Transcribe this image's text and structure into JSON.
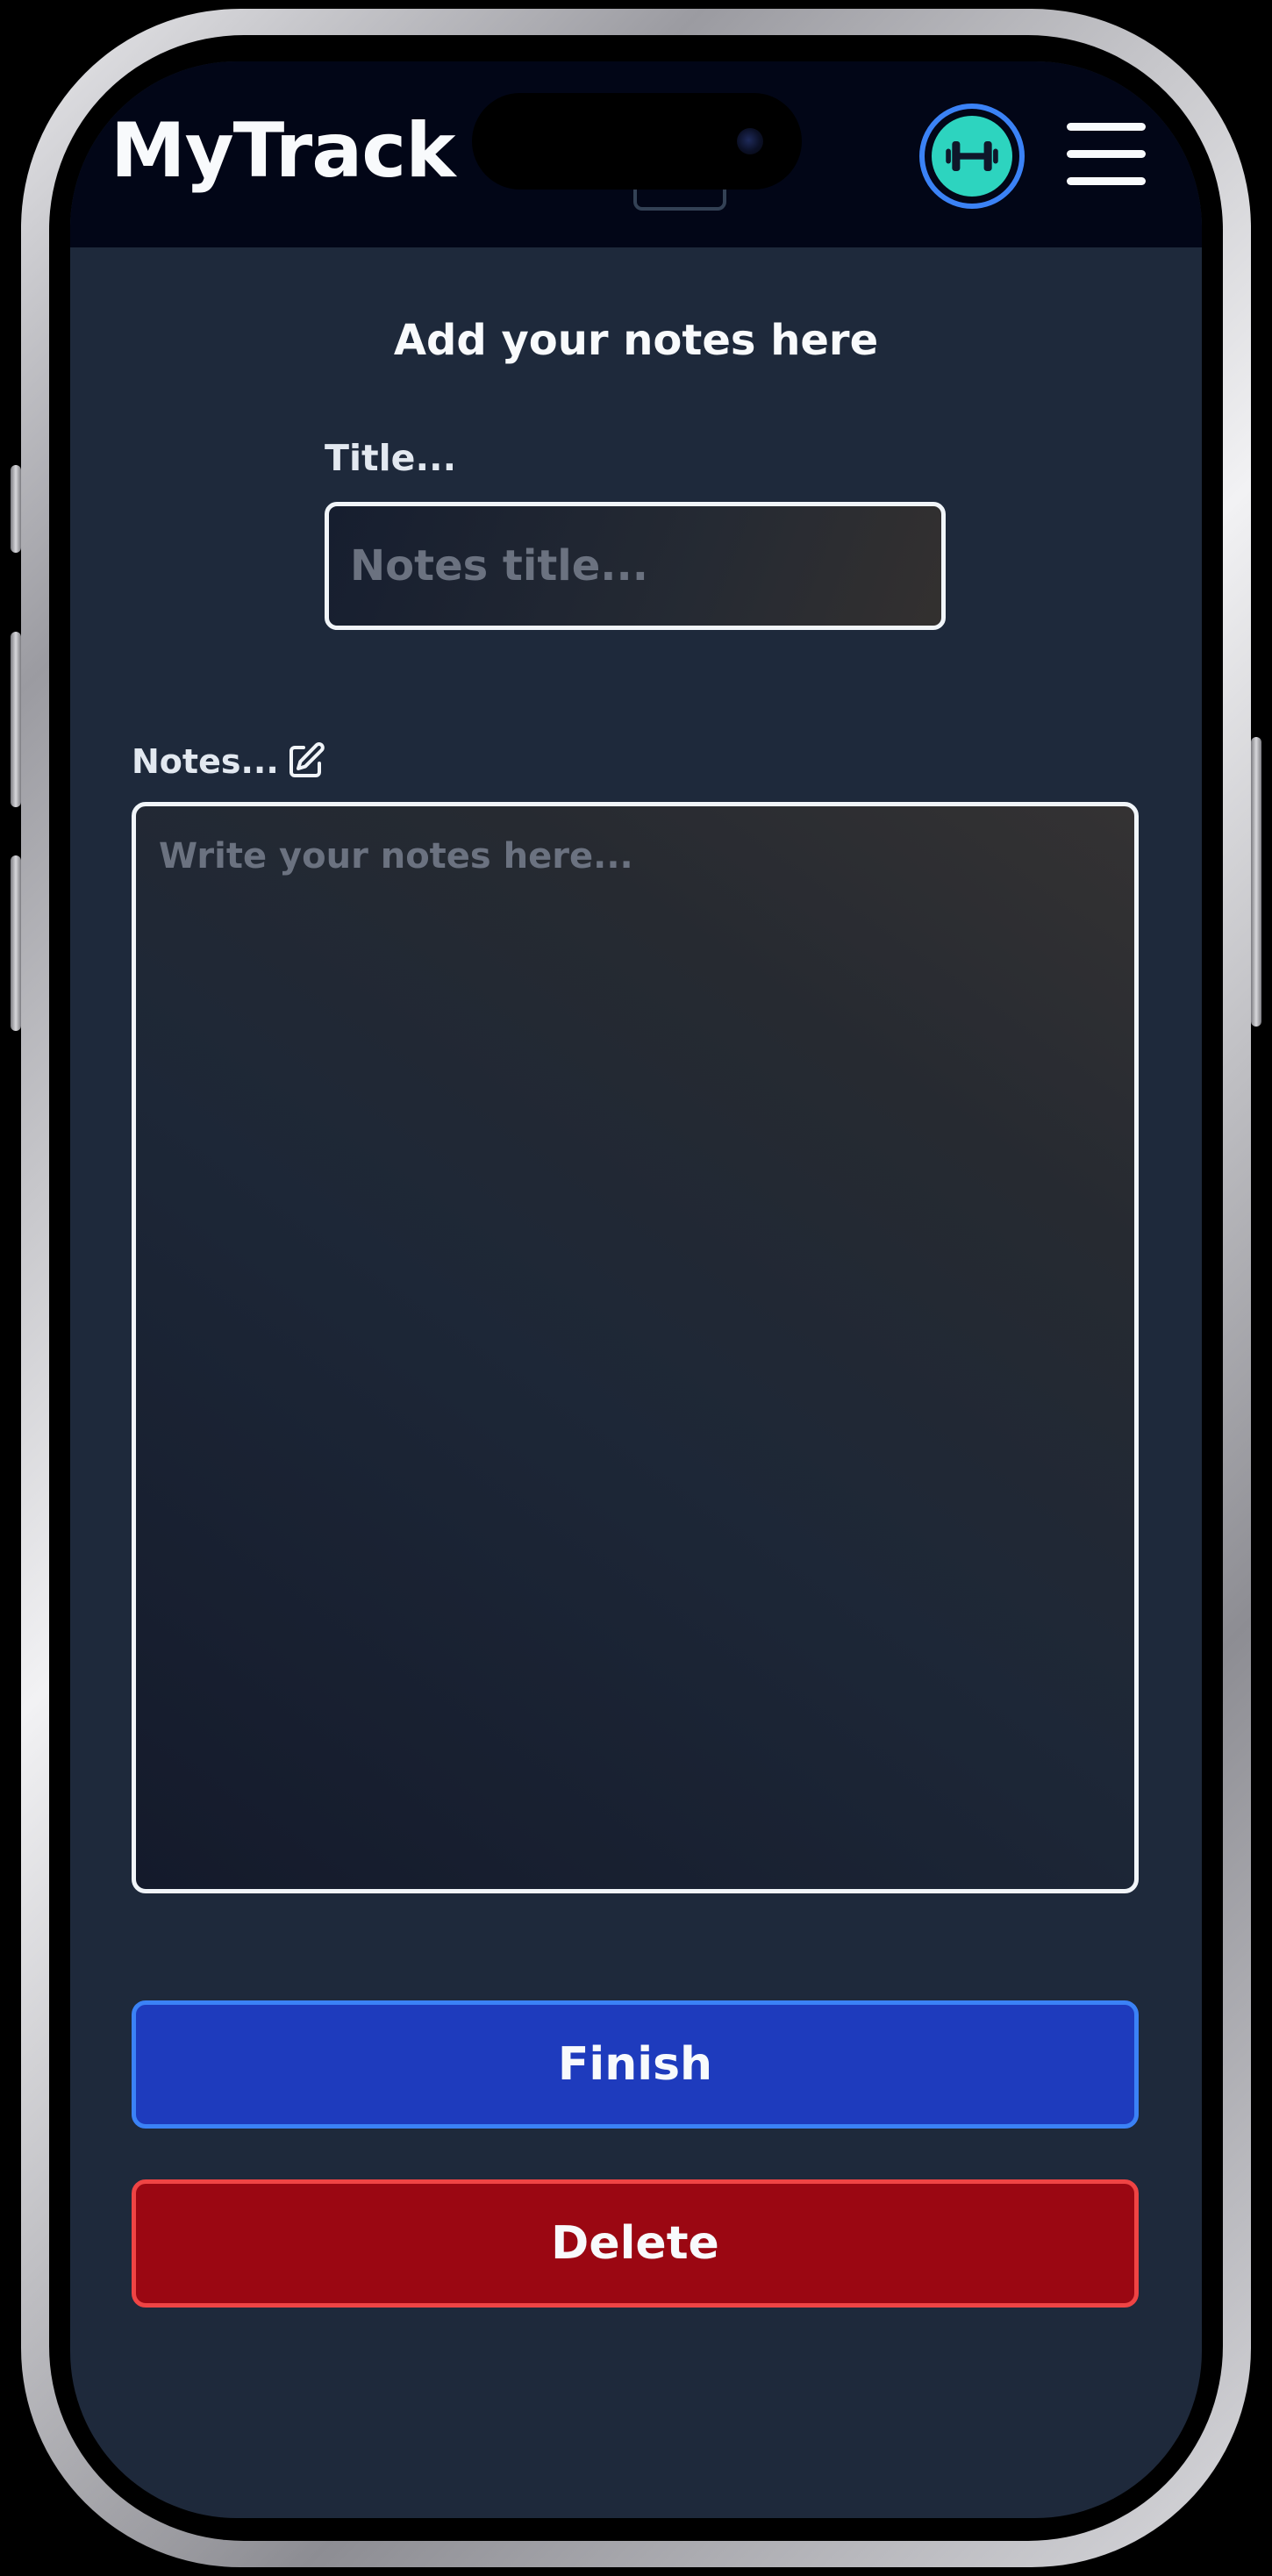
{
  "header": {
    "app_title": "MyTrack",
    "avatar_icon": "dumbbell-icon",
    "menu_icon": "hamburger-menu-icon"
  },
  "form": {
    "heading": "Add your notes here",
    "title_label": "Title...",
    "title_placeholder": "Notes title...",
    "title_value": "",
    "notes_label": "Notes...",
    "notes_icon": "edit-icon",
    "notes_placeholder": "Write your notes here...",
    "notes_value": ""
  },
  "actions": {
    "finish_label": "Finish",
    "delete_label": "Delete"
  },
  "colors": {
    "header_bg": "#020617",
    "screen_bg": "#1e293b",
    "avatar_ring": "#3b82f6",
    "avatar_fill": "#2dd4bf",
    "finish_bg": "#1e3bbd",
    "finish_border": "#3b82f6",
    "delete_bg": "#9b0712",
    "delete_border": "#ef4444"
  }
}
